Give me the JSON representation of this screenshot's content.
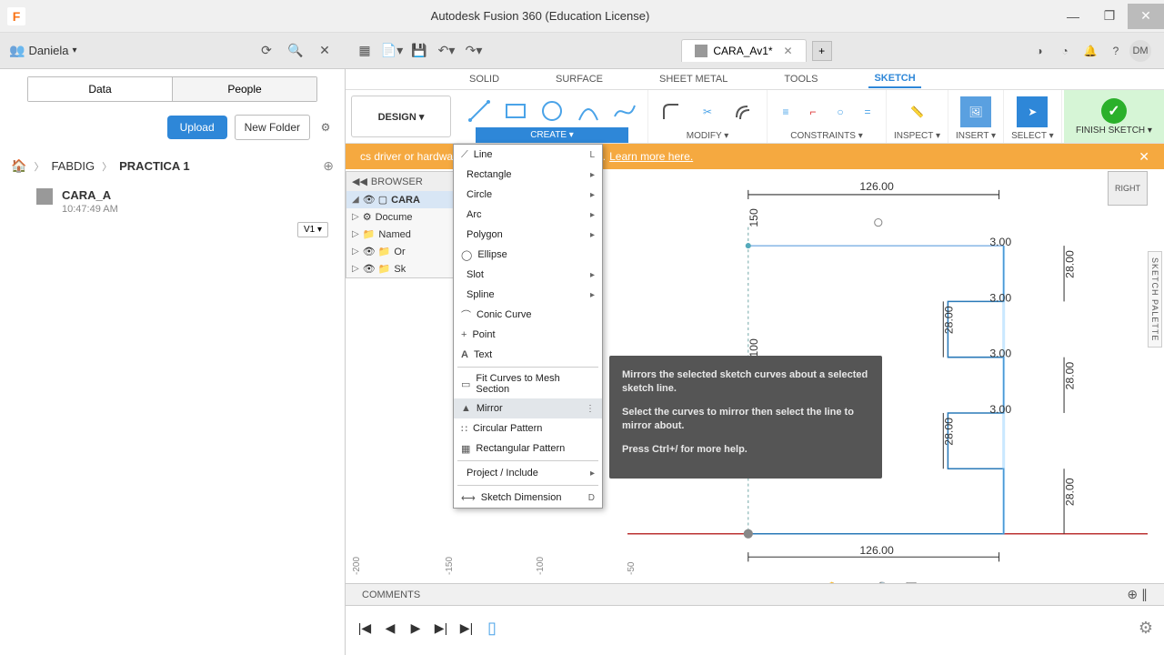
{
  "app": {
    "title": "Autodesk Fusion 360 (Education License)",
    "logo_letter": "F"
  },
  "user": {
    "name": "Daniela",
    "initials": "DM"
  },
  "data_panel": {
    "seg_data": "Data",
    "seg_people": "People",
    "upload": "Upload",
    "new_folder": "New Folder",
    "breadcrumb": {
      "lvl1": "FABDIG",
      "lvl2": "PRACTICA 1"
    },
    "file": {
      "name": "CARA_A",
      "time": "10:47:49 AM",
      "version": "V1 ▾"
    }
  },
  "doc_tab": {
    "name": "CARA_Av1*"
  },
  "env_tabs": {
    "solid": "SOLID",
    "surface": "SURFACE",
    "sheet": "SHEET METAL",
    "tools": "TOOLS",
    "sketch": "SKETCH"
  },
  "ribbon": {
    "design": "DESIGN ▾",
    "create": "CREATE ▾",
    "modify": "MODIFY ▾",
    "constraints": "CONSTRAINTS ▾",
    "inspect": "INSPECT ▾",
    "insert": "INSERT ▾",
    "select": "SELECT ▾",
    "finish": "FINISH SKETCH ▾"
  },
  "warning": {
    "text": "cs driver or hardware may be limiting performance.",
    "link": "Learn more here."
  },
  "browser": {
    "header": "BROWSER",
    "root": "CARA",
    "items": [
      "Docume",
      "Named",
      "Or",
      "Sk"
    ]
  },
  "create_menu": {
    "line": "Line",
    "line_sc": "L",
    "rectangle": "Rectangle",
    "circle": "Circle",
    "arc": "Arc",
    "polygon": "Polygon",
    "ellipse": "Ellipse",
    "slot": "Slot",
    "spline": "Spline",
    "conic": "Conic Curve",
    "point": "Point",
    "text": "Text",
    "fit": "Fit Curves to Mesh Section",
    "mirror": "Mirror",
    "circpat": "Circular Pattern",
    "rectpat": "Rectangular Pattern",
    "project": "Project / Include",
    "dim": "Sketch Dimension",
    "dim_sc": "D"
  },
  "tooltip": {
    "p1": "Mirrors the selected sketch curves about a selected sketch line.",
    "p2": "Select the curves to mirror then select the line to mirror about.",
    "p3": "Press Ctrl+/ for more help."
  },
  "viewcube": "RIGHT",
  "palette": "SKETCH PALETTE",
  "dims": {
    "d126_top": "126.00",
    "d126_bot": "126.00",
    "d150": "150",
    "d100": "100",
    "d3": "3.00",
    "d28": "28.00"
  },
  "ruler": {
    "t1": "-200",
    "t2": "-150",
    "t3": "-100",
    "t4": "-50"
  },
  "comments": "COMMENTS"
}
